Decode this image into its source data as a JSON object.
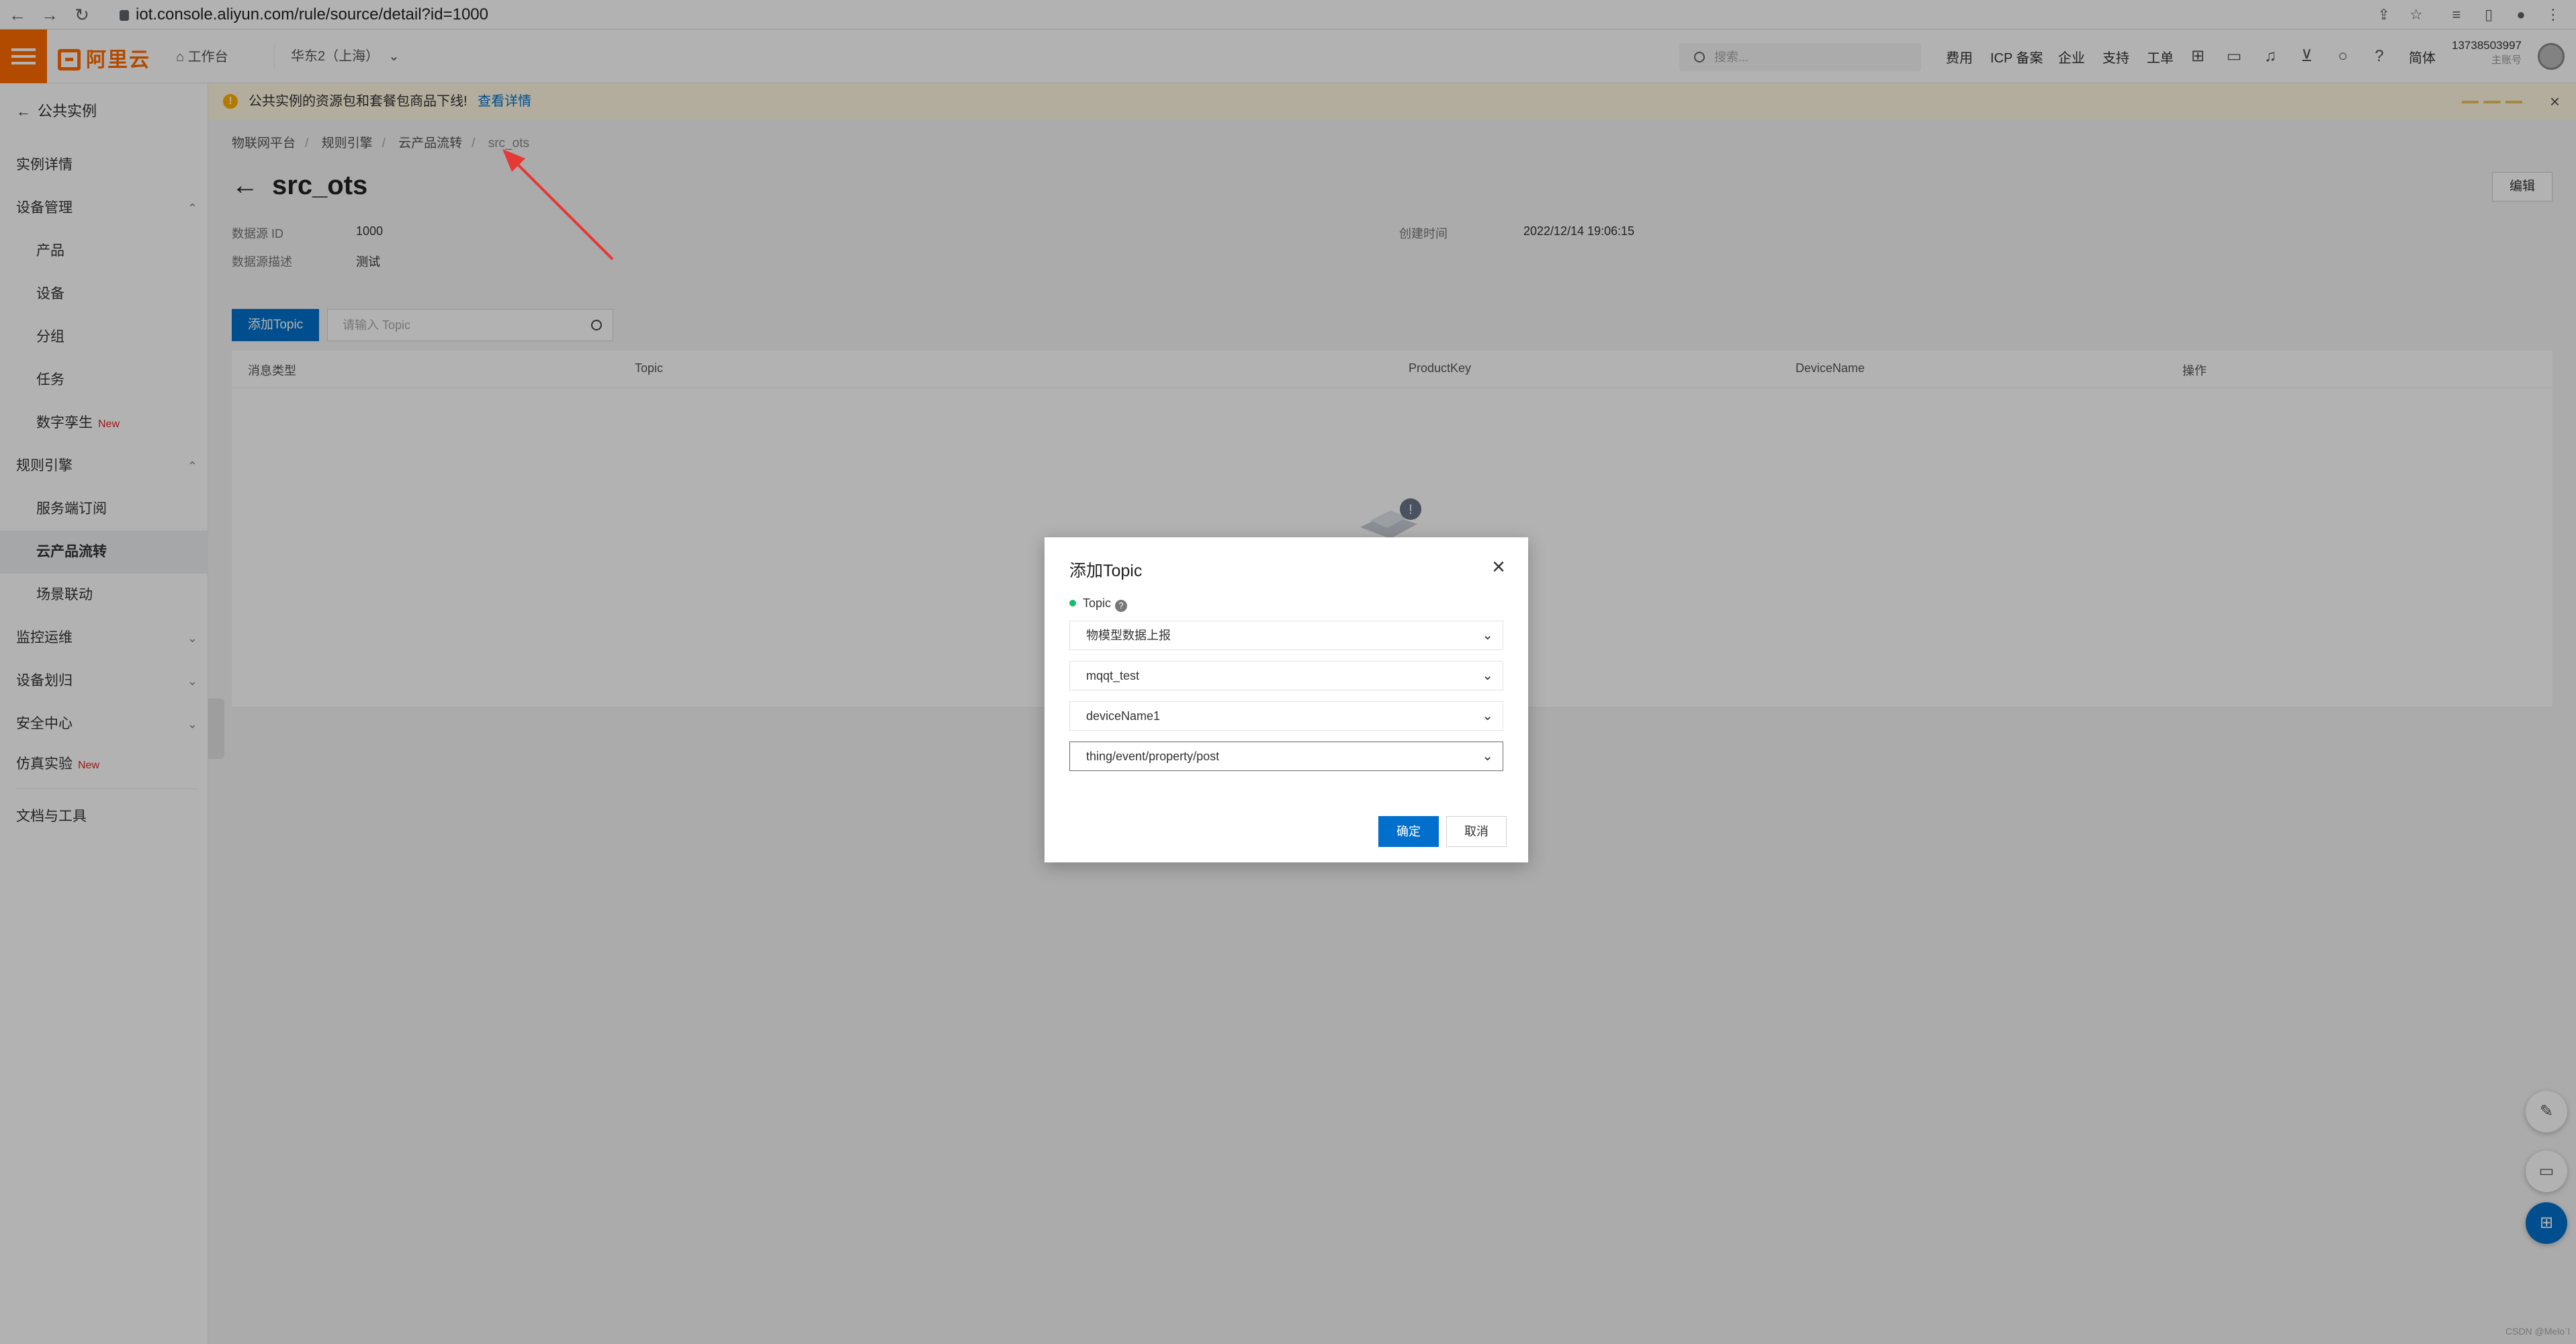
{
  "browser": {
    "url": "iot.console.aliyun.com/rule/source/detail?id=1000"
  },
  "header": {
    "logo": "阿里云",
    "workbench": "工作台",
    "region": "华东2（上海）",
    "search_placeholder": "搜索...",
    "nav": [
      "费用",
      "ICP 备案",
      "企业",
      "支持",
      "工单"
    ],
    "lang": "简体",
    "account_id": "13738503997",
    "account_sub": "主账号"
  },
  "sidebar": {
    "back_label": "公共实例",
    "items": [
      {
        "label": "实例详情"
      },
      {
        "label": "设备管理"
      },
      {
        "label": "产品"
      },
      {
        "label": "设备"
      },
      {
        "label": "分组"
      },
      {
        "label": "任务"
      },
      {
        "label": "数字孪生",
        "badge": "New"
      },
      {
        "label": "规则引擎"
      },
      {
        "label": "服务端订阅"
      },
      {
        "label": "云产品流转"
      },
      {
        "label": "场景联动"
      },
      {
        "label": "监控运维"
      },
      {
        "label": "设备划归"
      },
      {
        "label": "安全中心"
      },
      {
        "label": "仿真实验",
        "badge": "New"
      },
      {
        "label": "文档与工具"
      }
    ]
  },
  "notice": {
    "text": "公共实例的资源包和套餐包商品下线!",
    "link": "查看详情"
  },
  "breadcrumb": [
    "物联网平台",
    "规则引擎",
    "云产品流转",
    "src_ots"
  ],
  "page": {
    "title": "src_ots",
    "edit_label": "编辑",
    "source_id_label": "数据源 ID",
    "source_id": "1000",
    "desc_label": "数据源描述",
    "desc": "测试",
    "created_label": "创建时间",
    "created": "2022/12/14 19:06:15",
    "add_topic_label": "添加Topic",
    "topic_search_placeholder": "请输入 Topic",
    "columns": [
      "消息类型",
      "Topic",
      "ProductKey",
      "DeviceName",
      "操作"
    ]
  },
  "dialog": {
    "title": "添加Topic",
    "field_label": "Topic",
    "selects": [
      "物模型数据上报",
      "mqqt_test",
      "deviceName1",
      "thing/event/property/post"
    ],
    "ok_label": "确定",
    "cancel_label": "取消"
  },
  "watermark": "CSDN @Melo`l",
  "colors": {
    "brand": "#ff6a00",
    "primary": "#0070cc",
    "annotation": "#e53935"
  }
}
